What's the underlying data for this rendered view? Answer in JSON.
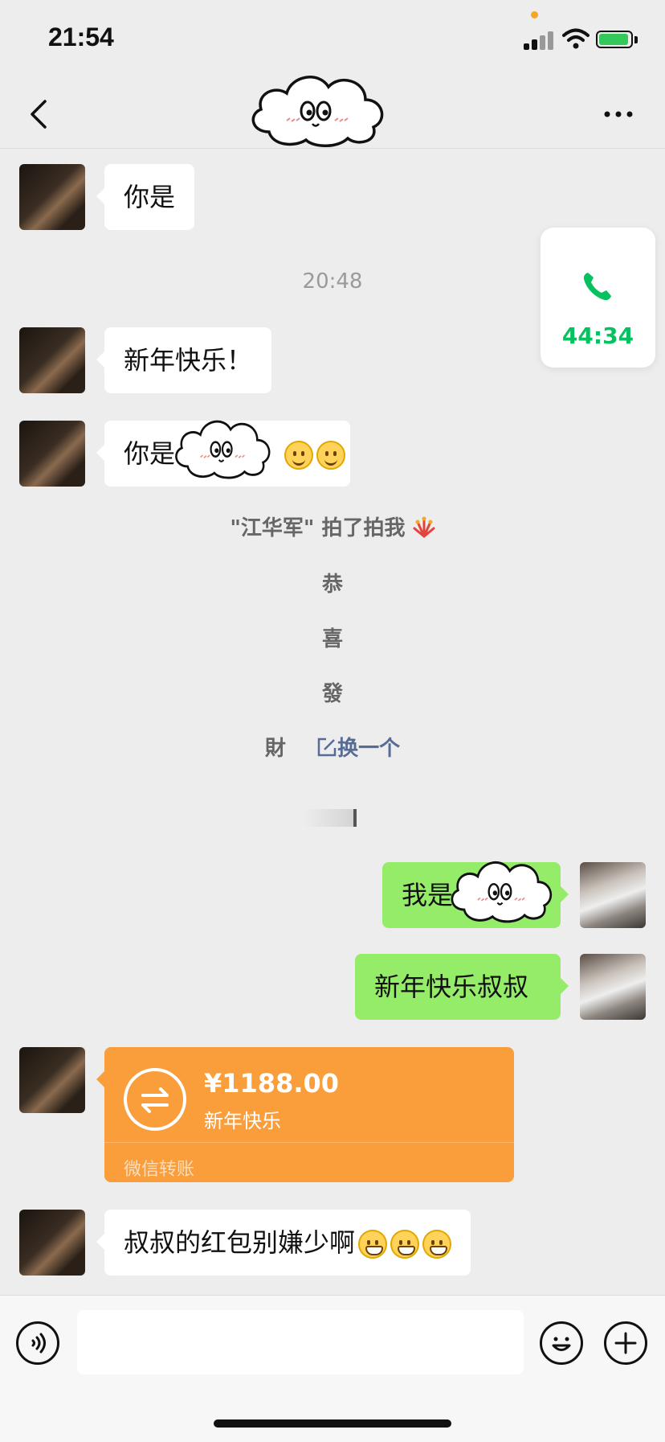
{
  "status_bar": {
    "time": "21:54"
  },
  "nav": {
    "title": ""
  },
  "call_card": {
    "duration": "44:34"
  },
  "messages": [
    {
      "text": "你是"
    },
    {
      "text": "新年快乐！"
    },
    {
      "text_prefix": "你是",
      "emoji_count": 2
    },
    {
      "text_prefix": "我是"
    },
    {
      "text": "新年快乐叔叔"
    },
    {
      "text": "叔叔的红包别嫌少啊",
      "emoji_count": 3
    }
  ],
  "timestamp": "20:48",
  "system": {
    "pat_text": "\"江华军\" 拍了拍我",
    "line1": "恭",
    "line2": "喜",
    "line3": "發",
    "line4": "財",
    "change_link": "换一个"
  },
  "transfer": {
    "amount": "¥1188.00",
    "note": "新年快乐",
    "footer": "微信转账"
  },
  "input": {
    "placeholder": ""
  },
  "colors": {
    "background": "#ededed",
    "bubble_self": "#95ec69",
    "bubble_other": "#ffffff",
    "transfer": "#fa9d3b",
    "call_green": "#07c160",
    "link_blue": "#576b95"
  },
  "icons": [
    "back-icon",
    "more-icon",
    "phone-icon",
    "voice-icon",
    "emoji-icon",
    "plus-icon",
    "transfer-icon",
    "edit-icon",
    "firecracker-icon"
  ]
}
